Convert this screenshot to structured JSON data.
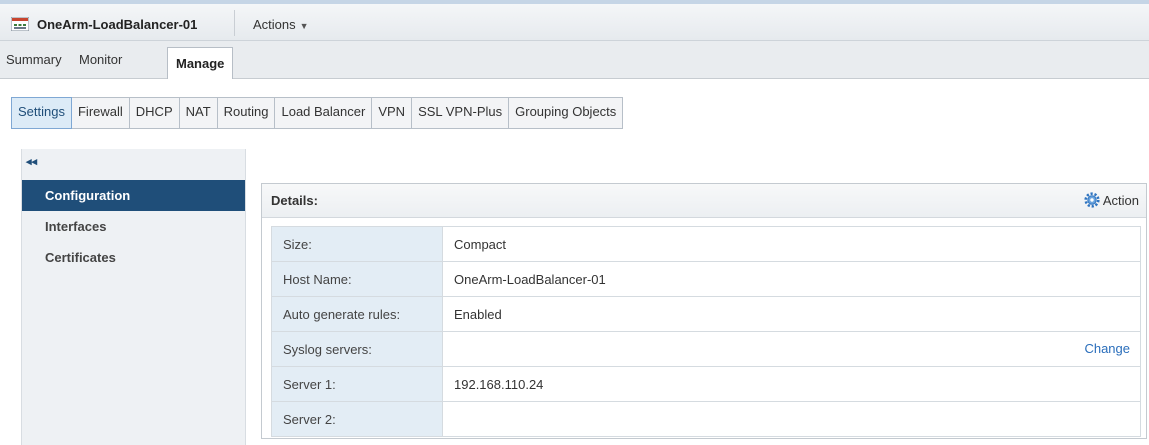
{
  "header": {
    "object_name": "OneArm-LoadBalancer-01",
    "actions_label": "Actions",
    "icon": "edge-appliance-icon"
  },
  "tabs": [
    {
      "label": "Summary",
      "active": false
    },
    {
      "label": "Monitor",
      "active": false
    },
    {
      "label": "Manage",
      "active": true
    }
  ],
  "subtabs": [
    {
      "label": "Settings",
      "active": true
    },
    {
      "label": "Firewall",
      "active": false
    },
    {
      "label": "DHCP",
      "active": false
    },
    {
      "label": "NAT",
      "active": false
    },
    {
      "label": "Routing",
      "active": false
    },
    {
      "label": "Load Balancer",
      "active": false
    },
    {
      "label": "VPN",
      "active": false
    },
    {
      "label": "SSL VPN-Plus",
      "active": false
    },
    {
      "label": "Grouping Objects",
      "active": false
    }
  ],
  "sidebar": {
    "collapse_icon": "double-chevron-left-icon",
    "collapse_glyph": "◂◂",
    "items": [
      {
        "label": "Configuration",
        "active": true
      },
      {
        "label": "Interfaces",
        "active": false
      },
      {
        "label": "Certificates",
        "active": false
      }
    ]
  },
  "details": {
    "title": "Details:",
    "action_label": "Action",
    "rows": [
      {
        "key": "Size:",
        "value": "Compact"
      },
      {
        "key": "Host Name:",
        "value": "OneArm-LoadBalancer-01"
      },
      {
        "key": "Auto generate rules:",
        "value": "Enabled"
      },
      {
        "key": "Syslog servers:",
        "value": "",
        "link": "Change"
      },
      {
        "key": "Server 1:",
        "value": "192.168.110.24"
      },
      {
        "key": "Server 2:",
        "value": ""
      }
    ]
  },
  "colors": {
    "accent": "#1f4e79",
    "link": "#2a6ebb",
    "key_cell_bg": "#e3edf5"
  }
}
